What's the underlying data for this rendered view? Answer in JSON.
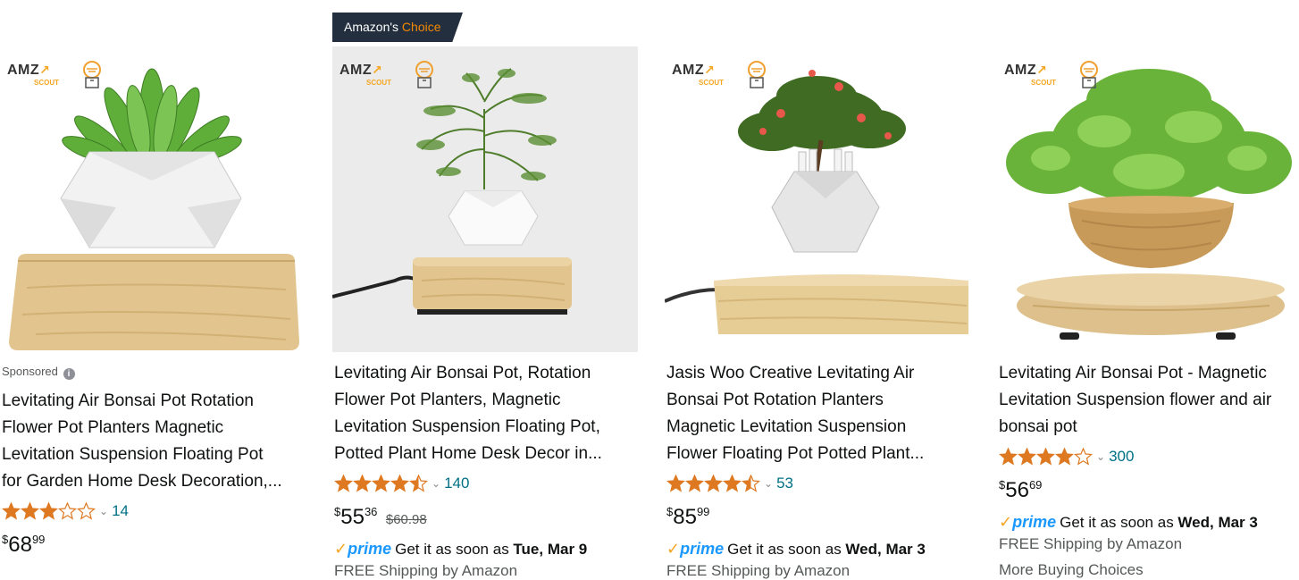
{
  "ext": {
    "amz_text": "AMZ",
    "scout_text": "SCOUT"
  },
  "cards": [
    {
      "sponsored": "Sponsored",
      "info_icon": "i",
      "title_lines": [
        "Levitating Air Bonsai Pot Rotation",
        "Flower Pot Planters Magnetic",
        "Levitation Suspension Floating Pot",
        "for Garden Home Desk Decoration,..."
      ],
      "rating": 3.0,
      "rating_count": "14",
      "price": {
        "sym": "$",
        "whole": "68",
        "frac": "99"
      }
    },
    {
      "badge": {
        "prefix": "Amazon's",
        "suffix": "Choice"
      },
      "title_lines": [
        "Levitating Air Bonsai Pot, Rotation",
        "Flower Pot Planters, Magnetic",
        "Levitation Suspension Floating Pot,",
        "Potted Plant Home Desk Decor in..."
      ],
      "rating": 4.5,
      "rating_count": "140",
      "price": {
        "sym": "$",
        "whole": "55",
        "frac": "36",
        "list": "$60.98"
      },
      "delivery": {
        "prefix": "Get it as soon as ",
        "date": "Tue, Mar 9"
      },
      "shipping": "FREE Shipping by Amazon"
    },
    {
      "title_lines": [
        "Jasis Woo Creative Levitating Air",
        "Bonsai Pot Rotation Planters",
        "Magnetic Levitation Suspension",
        "Flower Floating Pot Potted Plant..."
      ],
      "rating": 4.5,
      "rating_count": "53",
      "price": {
        "sym": "$",
        "whole": "85",
        "frac": "99"
      },
      "delivery": {
        "prefix": "Get it as soon as ",
        "date": "Wed, Mar 3"
      },
      "shipping": "FREE Shipping by Amazon"
    },
    {
      "title_lines": [
        "Levitating Air Bonsai Pot - Magnetic",
        "Levitation Suspension flower and air",
        "bonsai pot"
      ],
      "rating": 4.0,
      "rating_count": "300",
      "price": {
        "sym": "$",
        "whole": "56",
        "frac": "69"
      },
      "delivery": {
        "prefix": "Get it as soon as ",
        "date": "Wed, Mar 3"
      },
      "shipping": "FREE Shipping by Amazon",
      "more_choices": "More Buying Choices"
    }
  ],
  "prime_label": "prime",
  "colors": {
    "star": "#de7921",
    "link": "#007185",
    "prime": "#1a98ff",
    "badge_bg": "#232f3e",
    "badge_accent": "#f08804"
  }
}
